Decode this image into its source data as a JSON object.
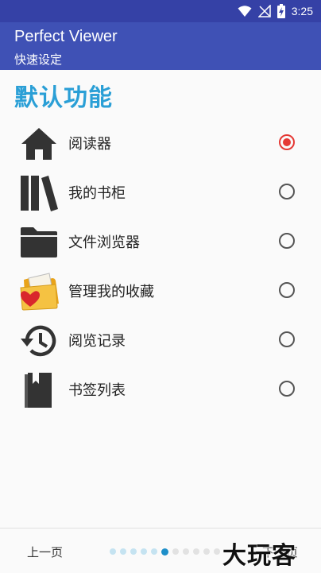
{
  "status_bar": {
    "time": "3:25"
  },
  "app_bar": {
    "title": "Perfect Viewer",
    "subtitle": "快速设定"
  },
  "section_title": "默认功能",
  "options": [
    {
      "label": "阅读器",
      "icon": "home-icon",
      "selected": true
    },
    {
      "label": "我的书柜",
      "icon": "bookshelf-icon",
      "selected": false
    },
    {
      "label": "文件浏览器",
      "icon": "folder-icon",
      "selected": false
    },
    {
      "label": "管理我的收藏",
      "icon": "favorite-folder-icon",
      "selected": false
    },
    {
      "label": "阅览记录",
      "icon": "history-icon",
      "selected": false
    },
    {
      "label": "书签列表",
      "icon": "bookmark-book-icon",
      "selected": false
    }
  ],
  "bottom_bar": {
    "prev_label": "上一页",
    "next_label": "下一页",
    "page_index": 5
  },
  "watermark": "大玩客",
  "colors": {
    "status_bar": "#3541a6",
    "app_bar": "#3f51b5",
    "accent_title": "#2a9fd6",
    "radio_selected": "#e53935",
    "dot_active": "#1e8fc9"
  }
}
